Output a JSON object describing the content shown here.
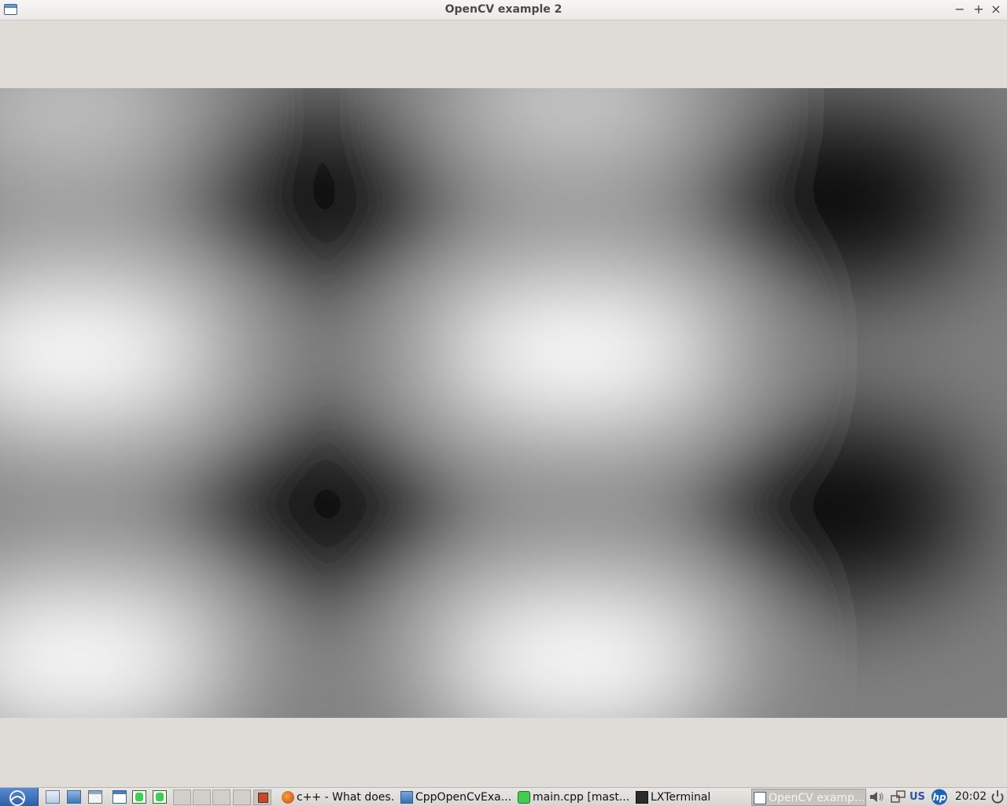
{
  "window": {
    "title": "OpenCV example 2",
    "minimize_glyph": "−",
    "maximize_glyph": "+",
    "close_glyph": "×",
    "icon": "window-icon"
  },
  "image": {
    "description_icon": "sinusoidal-grayscale-pattern"
  },
  "taskbar": {
    "start_icon": "start-menu-icon",
    "launchers": [
      "file-manager-icon",
      "network-icon",
      "window-icon",
      "show-desktop-icon",
      "qt-creator-icon",
      "qt-creator-icon"
    ],
    "tasks": [
      {
        "label": "c++ - What does...",
        "icon": "firefox-icon"
      },
      {
        "label": "CppOpenCvExa...",
        "icon": "folder-icon"
      },
      {
        "label": "main.cpp [mast...",
        "icon": "qt-creator-icon"
      },
      {
        "label": "LXTerminal",
        "icon": "terminal-icon"
      },
      {
        "label": "OpenCV examp...",
        "icon": "window-icon"
      }
    ],
    "tray": {
      "volume_icon": "volume-icon",
      "network_icon": "network-icon",
      "keyboard_layout": "US",
      "hp_icon": "hp-icon",
      "clock": "20:02",
      "power_icon": "power-icon"
    }
  },
  "colors": {
    "window_bg": "#dfdcd8",
    "accent": "#3b6fb6"
  }
}
